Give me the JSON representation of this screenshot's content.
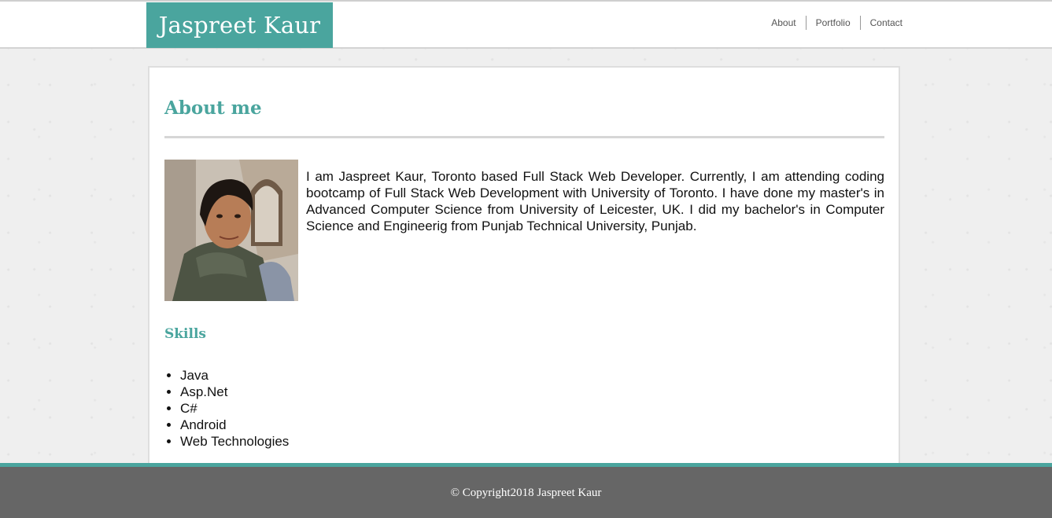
{
  "header": {
    "brand": "Jaspreet Kaur",
    "nav": [
      {
        "label": "About"
      },
      {
        "label": "Portfolio"
      },
      {
        "label": "Contact"
      }
    ]
  },
  "about": {
    "title": "About me",
    "bio": "I am Jaspreet Kaur, Toronto based Full Stack Web Developer. Currently, I am attending coding bootcamp of Full Stack Web Development with University of Toronto. I have done my master's in Advanced Computer Science from University of Leicester, UK. I did my bachelor's in Computer Science and Engineerig from Punjab Technical University, Punjab."
  },
  "skills": {
    "title": "Skills",
    "items": [
      "Java",
      "Asp.Net",
      "C#",
      "Android",
      "Web Technologies"
    ]
  },
  "footer": {
    "copyright": "© Copyright2018 Jaspreet Kaur"
  },
  "colors": {
    "accent": "#4aa59e",
    "footer_bg": "#666666"
  }
}
